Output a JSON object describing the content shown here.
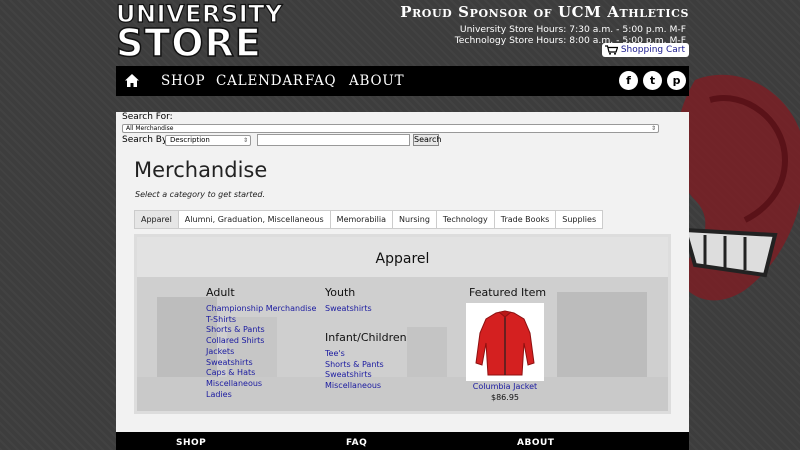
{
  "header": {
    "logo_line1": "UNIVERSITY",
    "logo_line2": "STORE",
    "sponsor": "Proud Sponsor of UCM Athletics",
    "hours_university": "University Store Hours: 7:30 a.m. - 5:00 p.m. M-F",
    "hours_technology": "Technology Store Hours: 8:00 a.m. - 5:00 p.m. M-F",
    "cart_label": "Shopping Cart"
  },
  "nav": {
    "items": [
      "SHOP",
      "CALENDAR",
      "FAQ",
      "ABOUT"
    ],
    "social": {
      "facebook": "f",
      "twitter": "t",
      "pinterest": "p"
    }
  },
  "search": {
    "search_for_label": "Search For:",
    "search_for_value": "All Merchandise",
    "search_by_label": "Search By:",
    "search_by_value": "Description",
    "input_value": "",
    "button_label": "Search"
  },
  "main": {
    "title": "Merchandise",
    "subtitle": "Select a category to get started.",
    "tabs": [
      "Apparel",
      "Alumni, Graduation, Miscellaneous",
      "Memorabilia",
      "Nursing",
      "Technology",
      "Trade Books",
      "Supplies"
    ],
    "active_tab": "Apparel"
  },
  "panel": {
    "title": "Apparel",
    "adult": {
      "heading": "Adult",
      "links": [
        "Championship Merchandise",
        "T-Shirts",
        "Shorts & Pants",
        "Collared Shirts",
        "Jackets",
        "Sweatshirts",
        "Caps & Hats",
        "Miscellaneous",
        "Ladies"
      ]
    },
    "youth": {
      "heading": "Youth",
      "links": [
        "Sweatshirts"
      ]
    },
    "infant": {
      "heading": "Infant/Children",
      "links": [
        "Tee's",
        "Shorts & Pants",
        "Sweatshirts",
        "Miscellaneous"
      ]
    },
    "featured": {
      "heading": "Featured Item",
      "name": "Columbia Jacket",
      "price": "$86.95"
    }
  },
  "footer": {
    "items": [
      "SHOP",
      "FAQ",
      "ABOUT"
    ]
  },
  "colors": {
    "background": "#3d3d3d",
    "nav": "#000000",
    "link": "#1a1aa0",
    "accent_red": "#d42020"
  }
}
